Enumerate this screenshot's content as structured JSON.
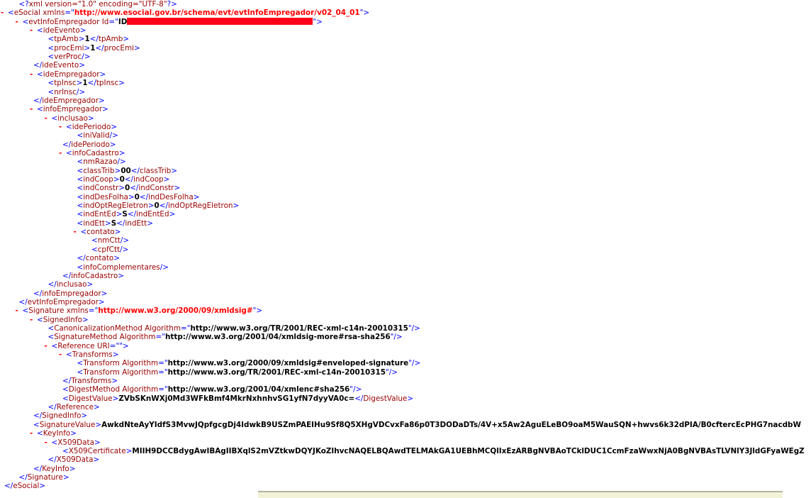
{
  "colors": {
    "markup": "#0000ff",
    "tag": "#990000",
    "collapse": "#ff0000",
    "redaction": "#ff0018"
  },
  "lines": [
    {
      "indent": 1,
      "col": "",
      "parts": [
        [
          "mk",
          "<?"
        ],
        [
          "tg",
          "xml version=\"1.0\" encoding=\"UTF-8\""
        ],
        [
          "mk",
          "?>"
        ]
      ]
    },
    {
      "indent": 0,
      "col": "-",
      "parts": [
        [
          "mk",
          "<"
        ],
        [
          "tg",
          "eSocial"
        ],
        [
          "an",
          " xmlns"
        ],
        [
          "mk",
          "=\""
        ],
        [
          "ns",
          "http://www.esocial.gov.br/schema/evt/evtInfoEmpregador/v02_04_01"
        ],
        [
          "mk",
          "\">"
        ]
      ]
    },
    {
      "indent": 1,
      "col": "-",
      "parts": [
        [
          "mk",
          "<"
        ],
        [
          "tg",
          "evtInfoEmpregador"
        ],
        [
          "an",
          " Id"
        ],
        [
          "mk",
          "=\""
        ],
        [
          "tx",
          "ID"
        ],
        [
          "redact",
          ""
        ],
        [
          "mk",
          "\">"
        ]
      ]
    },
    {
      "indent": 2,
      "col": "-",
      "parts": [
        [
          "mk",
          "<"
        ],
        [
          "tg",
          "ideEvento"
        ],
        [
          "mk",
          ">"
        ]
      ]
    },
    {
      "indent": 3,
      "col": "",
      "parts": [
        [
          "mk",
          "<"
        ],
        [
          "tg",
          "tpAmb"
        ],
        [
          "mk",
          ">"
        ],
        [
          "tx",
          "1"
        ],
        [
          "mk",
          "</"
        ],
        [
          "tg",
          "tpAmb"
        ],
        [
          "mk",
          ">"
        ]
      ]
    },
    {
      "indent": 3,
      "col": "",
      "parts": [
        [
          "mk",
          "<"
        ],
        [
          "tg",
          "procEmi"
        ],
        [
          "mk",
          ">"
        ],
        [
          "tx",
          "1"
        ],
        [
          "mk",
          "</"
        ],
        [
          "tg",
          "procEmi"
        ],
        [
          "mk",
          ">"
        ]
      ]
    },
    {
      "indent": 3,
      "col": "",
      "parts": [
        [
          "mk",
          "<"
        ],
        [
          "tg",
          "verProc"
        ],
        [
          "mk",
          "/>"
        ]
      ]
    },
    {
      "indent": 2,
      "col": "",
      "parts": [
        [
          "mk",
          "</"
        ],
        [
          "tg",
          "ideEvento"
        ],
        [
          "mk",
          ">"
        ]
      ]
    },
    {
      "indent": 2,
      "col": "-",
      "parts": [
        [
          "mk",
          "<"
        ],
        [
          "tg",
          "ideEmpregador"
        ],
        [
          "mk",
          ">"
        ]
      ]
    },
    {
      "indent": 3,
      "col": "",
      "parts": [
        [
          "mk",
          "<"
        ],
        [
          "tg",
          "tpInsc"
        ],
        [
          "mk",
          ">"
        ],
        [
          "tx",
          "1"
        ],
        [
          "mk",
          "</"
        ],
        [
          "tg",
          "tpInsc"
        ],
        [
          "mk",
          ">"
        ]
      ]
    },
    {
      "indent": 3,
      "col": "",
      "parts": [
        [
          "mk",
          "<"
        ],
        [
          "tg",
          "nrInsc"
        ],
        [
          "mk",
          "/>"
        ]
      ]
    },
    {
      "indent": 2,
      "col": "",
      "parts": [
        [
          "mk",
          "</"
        ],
        [
          "tg",
          "ideEmpregador"
        ],
        [
          "mk",
          ">"
        ]
      ]
    },
    {
      "indent": 2,
      "col": "-",
      "parts": [
        [
          "mk",
          "<"
        ],
        [
          "tg",
          "infoEmpregador"
        ],
        [
          "mk",
          ">"
        ]
      ]
    },
    {
      "indent": 3,
      "col": "-",
      "parts": [
        [
          "mk",
          "<"
        ],
        [
          "tg",
          "inclusao"
        ],
        [
          "mk",
          ">"
        ]
      ]
    },
    {
      "indent": 4,
      "col": "-",
      "parts": [
        [
          "mk",
          "<"
        ],
        [
          "tg",
          "idePeriodo"
        ],
        [
          "mk",
          ">"
        ]
      ]
    },
    {
      "indent": 5,
      "col": "",
      "parts": [
        [
          "mk",
          "<"
        ],
        [
          "tg",
          "iniValid"
        ],
        [
          "mk",
          "/>"
        ]
      ]
    },
    {
      "indent": 4,
      "col": "",
      "parts": [
        [
          "mk",
          "</"
        ],
        [
          "tg",
          "idePeriodo"
        ],
        [
          "mk",
          ">"
        ]
      ]
    },
    {
      "indent": 4,
      "col": "-",
      "parts": [
        [
          "mk",
          "<"
        ],
        [
          "tg",
          "infoCadastro"
        ],
        [
          "mk",
          ">"
        ]
      ]
    },
    {
      "indent": 5,
      "col": "",
      "parts": [
        [
          "mk",
          "<"
        ],
        [
          "tg",
          "nmRazao"
        ],
        [
          "mk",
          "/>"
        ]
      ]
    },
    {
      "indent": 5,
      "col": "",
      "parts": [
        [
          "mk",
          "<"
        ],
        [
          "tg",
          "classTrib"
        ],
        [
          "mk",
          ">"
        ],
        [
          "tx",
          "00"
        ],
        [
          "mk",
          "</"
        ],
        [
          "tg",
          "classTrib"
        ],
        [
          "mk",
          ">"
        ]
      ]
    },
    {
      "indent": 5,
      "col": "",
      "parts": [
        [
          "mk",
          "<"
        ],
        [
          "tg",
          "indCoop"
        ],
        [
          "mk",
          ">"
        ],
        [
          "tx",
          "0"
        ],
        [
          "mk",
          "</"
        ],
        [
          "tg",
          "indCoop"
        ],
        [
          "mk",
          ">"
        ]
      ]
    },
    {
      "indent": 5,
      "col": "",
      "parts": [
        [
          "mk",
          "<"
        ],
        [
          "tg",
          "indConstr"
        ],
        [
          "mk",
          ">"
        ],
        [
          "tx",
          "0"
        ],
        [
          "mk",
          "</"
        ],
        [
          "tg",
          "indConstr"
        ],
        [
          "mk",
          ">"
        ]
      ]
    },
    {
      "indent": 5,
      "col": "",
      "parts": [
        [
          "mk",
          "<"
        ],
        [
          "tg",
          "indDesFolha"
        ],
        [
          "mk",
          ">"
        ],
        [
          "tx",
          "0"
        ],
        [
          "mk",
          "</"
        ],
        [
          "tg",
          "indDesFolha"
        ],
        [
          "mk",
          ">"
        ]
      ]
    },
    {
      "indent": 5,
      "col": "",
      "parts": [
        [
          "mk",
          "<"
        ],
        [
          "tg",
          "indOptRegEletron"
        ],
        [
          "mk",
          ">"
        ],
        [
          "tx",
          "0"
        ],
        [
          "mk",
          "</"
        ],
        [
          "tg",
          "indOptRegEletron"
        ],
        [
          "mk",
          ">"
        ]
      ]
    },
    {
      "indent": 5,
      "col": "",
      "parts": [
        [
          "mk",
          "<"
        ],
        [
          "tg",
          "indEntEd"
        ],
        [
          "mk",
          ">"
        ],
        [
          "tx",
          "S"
        ],
        [
          "mk",
          "</"
        ],
        [
          "tg",
          "indEntEd"
        ],
        [
          "mk",
          ">"
        ]
      ]
    },
    {
      "indent": 5,
      "col": "",
      "parts": [
        [
          "mk",
          "<"
        ],
        [
          "tg",
          "indEtt"
        ],
        [
          "mk",
          ">"
        ],
        [
          "tx",
          "S"
        ],
        [
          "mk",
          "</"
        ],
        [
          "tg",
          "indEtt"
        ],
        [
          "mk",
          ">"
        ]
      ]
    },
    {
      "indent": 5,
      "col": "-",
      "parts": [
        [
          "mk",
          "<"
        ],
        [
          "tg",
          "contato"
        ],
        [
          "mk",
          ">"
        ]
      ]
    },
    {
      "indent": 6,
      "col": "",
      "parts": [
        [
          "mk",
          "<"
        ],
        [
          "tg",
          "nmCtt"
        ],
        [
          "mk",
          "/>"
        ]
      ]
    },
    {
      "indent": 6,
      "col": "",
      "parts": [
        [
          "mk",
          "<"
        ],
        [
          "tg",
          "cpfCtt"
        ],
        [
          "mk",
          "/>"
        ]
      ]
    },
    {
      "indent": 5,
      "col": "",
      "parts": [
        [
          "mk",
          "</"
        ],
        [
          "tg",
          "contato"
        ],
        [
          "mk",
          ">"
        ]
      ]
    },
    {
      "indent": 5,
      "col": "",
      "parts": [
        [
          "mk",
          "<"
        ],
        [
          "tg",
          "infoComplementares"
        ],
        [
          "mk",
          "/>"
        ]
      ]
    },
    {
      "indent": 4,
      "col": "",
      "parts": [
        [
          "mk",
          "</"
        ],
        [
          "tg",
          "infoCadastro"
        ],
        [
          "mk",
          ">"
        ]
      ]
    },
    {
      "indent": 3,
      "col": "",
      "parts": [
        [
          "mk",
          "</"
        ],
        [
          "tg",
          "inclusao"
        ],
        [
          "mk",
          ">"
        ]
      ]
    },
    {
      "indent": 2,
      "col": "",
      "parts": [
        [
          "mk",
          "</"
        ],
        [
          "tg",
          "infoEmpregador"
        ],
        [
          "mk",
          ">"
        ]
      ]
    },
    {
      "indent": 1,
      "col": "",
      "parts": [
        [
          "mk",
          "</"
        ],
        [
          "tg",
          "evtInfoEmpregador"
        ],
        [
          "mk",
          ">"
        ]
      ]
    },
    {
      "indent": 1,
      "col": "-",
      "parts": [
        [
          "mk",
          "<"
        ],
        [
          "tg",
          "Signature"
        ],
        [
          "an",
          " xmlns"
        ],
        [
          "mk",
          "=\""
        ],
        [
          "ns",
          "http://www.w3.org/2000/09/xmldsig#"
        ],
        [
          "mk",
          "\">"
        ]
      ]
    },
    {
      "indent": 2,
      "col": "-",
      "parts": [
        [
          "mk",
          "<"
        ],
        [
          "tg",
          "SignedInfo"
        ],
        [
          "mk",
          ">"
        ]
      ]
    },
    {
      "indent": 3,
      "col": "",
      "parts": [
        [
          "mk",
          "<"
        ],
        [
          "tg",
          "CanonicalizationMethod"
        ],
        [
          "an",
          " Algorithm"
        ],
        [
          "mk",
          "=\""
        ],
        [
          "tx",
          "http://www.w3.org/TR/2001/REC-xml-c14n-20010315"
        ],
        [
          "mk",
          "\"/>"
        ]
      ]
    },
    {
      "indent": 3,
      "col": "",
      "parts": [
        [
          "mk",
          "<"
        ],
        [
          "tg",
          "SignatureMethod"
        ],
        [
          "an",
          " Algorithm"
        ],
        [
          "mk",
          "=\""
        ],
        [
          "tx",
          "http://www.w3.org/2001/04/xmldsig-more#rsa-sha256"
        ],
        [
          "mk",
          "\"/>"
        ]
      ]
    },
    {
      "indent": 3,
      "col": "-",
      "parts": [
        [
          "mk",
          "<"
        ],
        [
          "tg",
          "Reference"
        ],
        [
          "an",
          " URI"
        ],
        [
          "mk",
          "=\"\">"
        ]
      ]
    },
    {
      "indent": 4,
      "col": "-",
      "parts": [
        [
          "mk",
          "<"
        ],
        [
          "tg",
          "Transforms"
        ],
        [
          "mk",
          ">"
        ]
      ]
    },
    {
      "indent": 5,
      "col": "",
      "parts": [
        [
          "mk",
          "<"
        ],
        [
          "tg",
          "Transform"
        ],
        [
          "an",
          " Algorithm"
        ],
        [
          "mk",
          "=\""
        ],
        [
          "tx",
          "http://www.w3.org/2000/09/xmldsig#enveloped-signature"
        ],
        [
          "mk",
          "\"/>"
        ]
      ]
    },
    {
      "indent": 5,
      "col": "",
      "parts": [
        [
          "mk",
          "<"
        ],
        [
          "tg",
          "Transform"
        ],
        [
          "an",
          " Algorithm"
        ],
        [
          "mk",
          "=\""
        ],
        [
          "tx",
          "http://www.w3.org/TR/2001/REC-xml-c14n-20010315"
        ],
        [
          "mk",
          "\"/>"
        ]
      ]
    },
    {
      "indent": 4,
      "col": "",
      "parts": [
        [
          "mk",
          "</"
        ],
        [
          "tg",
          "Transforms"
        ],
        [
          "mk",
          ">"
        ]
      ]
    },
    {
      "indent": 4,
      "col": "",
      "parts": [
        [
          "mk",
          "<"
        ],
        [
          "tg",
          "DigestMethod"
        ],
        [
          "an",
          " Algorithm"
        ],
        [
          "mk",
          "=\""
        ],
        [
          "tx",
          "http://www.w3.org/2001/04/xmlenc#sha256"
        ],
        [
          "mk",
          "\"/>"
        ]
      ]
    },
    {
      "indent": 4,
      "col": "",
      "parts": [
        [
          "mk",
          "<"
        ],
        [
          "tg",
          "DigestValue"
        ],
        [
          "mk",
          ">"
        ],
        [
          "tx",
          "ZVbSKnWXj0Md3WFkBmf4MkrNxhnhvSG1yfN7dyyVA0c="
        ],
        [
          "mk",
          "</"
        ],
        [
          "tg",
          "DigestValue"
        ],
        [
          "mk",
          ">"
        ]
      ]
    },
    {
      "indent": 3,
      "col": "",
      "parts": [
        [
          "mk",
          "</"
        ],
        [
          "tg",
          "Reference"
        ],
        [
          "mk",
          ">"
        ]
      ]
    },
    {
      "indent": 2,
      "col": "",
      "parts": [
        [
          "mk",
          "</"
        ],
        [
          "tg",
          "SignedInfo"
        ],
        [
          "mk",
          ">"
        ]
      ]
    },
    {
      "indent": 2,
      "col": "",
      "parts": [
        [
          "mk",
          "<"
        ],
        [
          "tg",
          "SignatureValue"
        ],
        [
          "mk",
          ">"
        ],
        [
          "tx",
          "AwkdNteAyYIdfS3MvwJQpfgcgDj4IdwkB9USZmPAEIHu9Sf8Q5XHgVDCvxFa86p0T3DODaDTs/4V+x5Aw2AguELeBO9oaM5WauSQN+hwvs6k32dPIA/B0cftercEcPHG7nacdbW"
        ]
      ]
    },
    {
      "indent": 2,
      "col": "-",
      "parts": [
        [
          "mk",
          "<"
        ],
        [
          "tg",
          "KeyInfo"
        ],
        [
          "mk",
          ">"
        ]
      ]
    },
    {
      "indent": 3,
      "col": "-",
      "parts": [
        [
          "mk",
          "<"
        ],
        [
          "tg",
          "X509Data"
        ],
        [
          "mk",
          ">"
        ]
      ]
    },
    {
      "indent": 4,
      "col": "",
      "parts": [
        [
          "mk",
          "<"
        ],
        [
          "tg",
          "X509Certificate"
        ],
        [
          "mk",
          ">"
        ],
        [
          "tx",
          "MIIH9DCCBdygAwIBAgIIBXqlS2mVZtkwDQYJKoZIhvcNAQELBQAwdTELMAkGA1UEBhMCQlIxEzARBgNVBAoTCklDUC1CcmFzaWwxNjA0BgNVBAsTLVNlY3JldGFyaWEgZ"
        ]
      ]
    },
    {
      "indent": 3,
      "col": "",
      "parts": [
        [
          "mk",
          "</"
        ],
        [
          "tg",
          "X509Data"
        ],
        [
          "mk",
          ">"
        ]
      ]
    },
    {
      "indent": 2,
      "col": "",
      "parts": [
        [
          "mk",
          "</"
        ],
        [
          "tg",
          "KeyInfo"
        ],
        [
          "mk",
          ">"
        ]
      ]
    },
    {
      "indent": 1,
      "col": "",
      "parts": [
        [
          "mk",
          "</"
        ],
        [
          "tg",
          "Signature"
        ],
        [
          "mk",
          ">"
        ]
      ]
    },
    {
      "indent": 0,
      "col": "",
      "parts": [
        [
          "mk",
          "</"
        ],
        [
          "tg",
          "eSocial"
        ],
        [
          "mk",
          ">"
        ]
      ]
    }
  ]
}
